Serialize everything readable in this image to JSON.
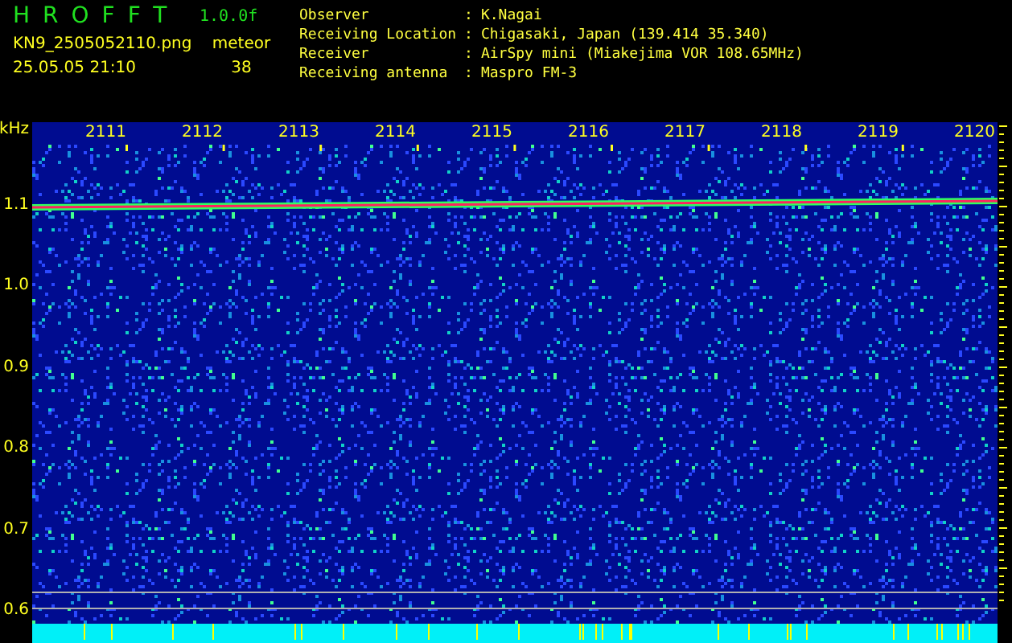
{
  "app": {
    "title": "HROFFT",
    "version": "1.0.0f"
  },
  "file": {
    "name": "KN9_2505052110.png",
    "timestamp": "25.05.05 21:10"
  },
  "meteor_count": {
    "label": "meteor",
    "value": "38"
  },
  "info": [
    {
      "label": "Observer",
      "separator": ":",
      "value": "K.Nagai"
    },
    {
      "label": "Receiving Location",
      "separator": ":",
      "value": "Chigasaki, Japan (139.414 35.340)"
    },
    {
      "label": "Receiver",
      "separator": ":",
      "value": "AirSpy mini (Miakejima VOR 108.65MHz)"
    },
    {
      "label": "Receiving antenna",
      "separator": ":",
      "value": "Maspro FM-3"
    }
  ],
  "spectrogram": {
    "y_unit": "kHz",
    "y_ticks": [
      "1.1",
      "1.0",
      "0.9",
      "0.8",
      "0.7",
      "0.6"
    ],
    "time_labels": [
      "2111",
      "2112",
      "2113",
      "2114",
      "2115",
      "2116",
      "2117",
      "2118",
      "2119",
      "2120"
    ]
  }
}
